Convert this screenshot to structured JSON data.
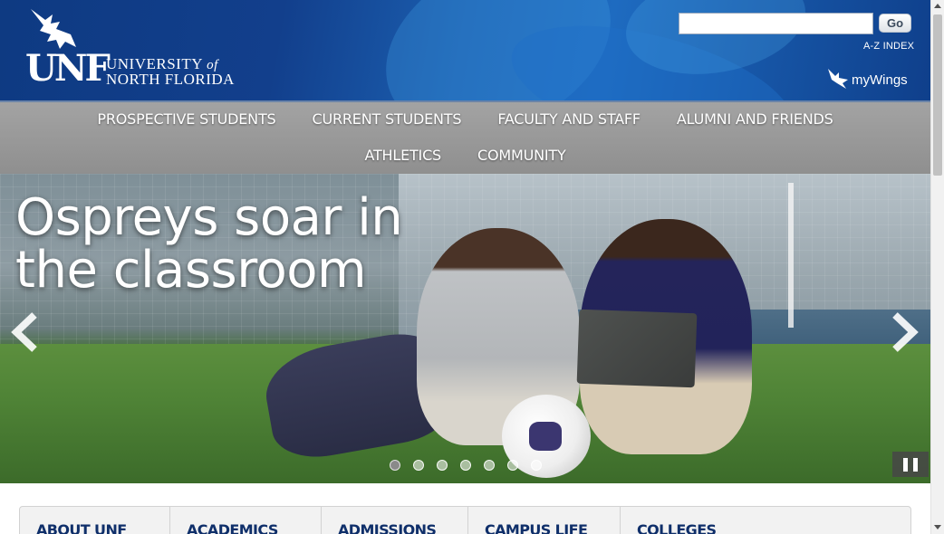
{
  "header": {
    "logo": {
      "mark": "UNF",
      "line1_main": "UNIVERSITY",
      "line1_of": "of",
      "line2": "NORTH FLORIDA"
    },
    "search": {
      "value": "",
      "placeholder": "",
      "go_label": "Go"
    },
    "az_index": "A-Z INDEX",
    "mywings": "myWings",
    "colors": {
      "header_blue": "#123f8c",
      "nav_gray": "#9a9a9a",
      "tab_text": "#0f2f6a"
    }
  },
  "nav": {
    "row1": [
      "PROSPECTIVE STUDENTS",
      "CURRENT STUDENTS",
      "FACULTY AND STAFF",
      "ALUMNI AND FRIENDS"
    ],
    "row2": [
      "ATHLETICS",
      "COMMUNITY"
    ]
  },
  "hero": {
    "headline_line1": "Ospreys soar in",
    "headline_line2": "the classroom",
    "slide_count": 7,
    "active_slide": 1
  },
  "tabs": [
    "ABOUT UNF",
    "ACADEMICS",
    "ADMISSIONS",
    "CAMPUS LIFE",
    "COLLEGES"
  ],
  "icons": {
    "logo_bird": "osprey-icon",
    "prev": "chevron-left-icon",
    "next": "chevron-right-icon",
    "pause": "pause-icon",
    "mywings_wing": "wing-icon"
  }
}
